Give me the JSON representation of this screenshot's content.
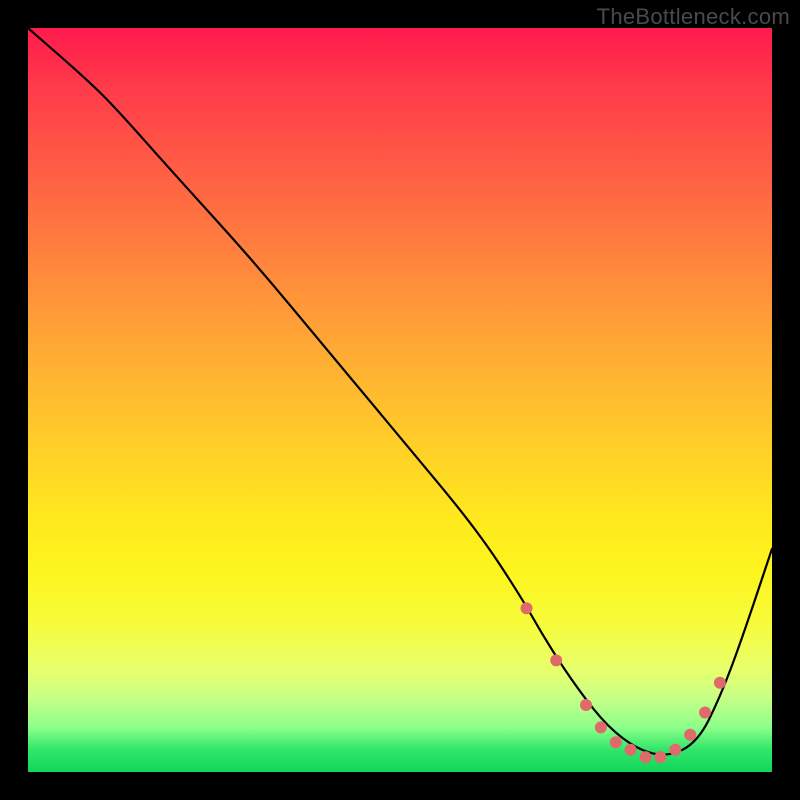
{
  "watermark": "TheBottleneck.com",
  "chart_data": {
    "type": "line",
    "title": "",
    "xlabel": "",
    "ylabel": "",
    "xlim": [
      0,
      100
    ],
    "ylim": [
      0,
      100
    ],
    "grid": false,
    "legend": false,
    "curve": {
      "name": "bottleneck-curve",
      "color": "#000000",
      "x": [
        0,
        8,
        12,
        20,
        30,
        40,
        50,
        60,
        66,
        70,
        74,
        78,
        82,
        86,
        90,
        93,
        96,
        100
      ],
      "y": [
        100,
        93,
        89,
        80,
        69,
        57,
        45,
        33,
        24,
        17,
        11,
        6,
        3,
        2,
        4,
        10,
        18,
        30
      ]
    },
    "markers": {
      "name": "highlighted-points",
      "color": "#e06a6a",
      "x": [
        67,
        71,
        75,
        77,
        79,
        81,
        83,
        85,
        87,
        89,
        91,
        93
      ],
      "y": [
        22,
        15,
        9,
        6,
        4,
        3,
        2,
        2,
        3,
        5,
        8,
        12
      ]
    },
    "background_gradient": {
      "stops": [
        {
          "pos": 0,
          "color": "#ff1a4d"
        },
        {
          "pos": 50,
          "color": "#ffb830"
        },
        {
          "pos": 75,
          "color": "#fdf51e"
        },
        {
          "pos": 100,
          "color": "#11d65a"
        }
      ]
    }
  }
}
